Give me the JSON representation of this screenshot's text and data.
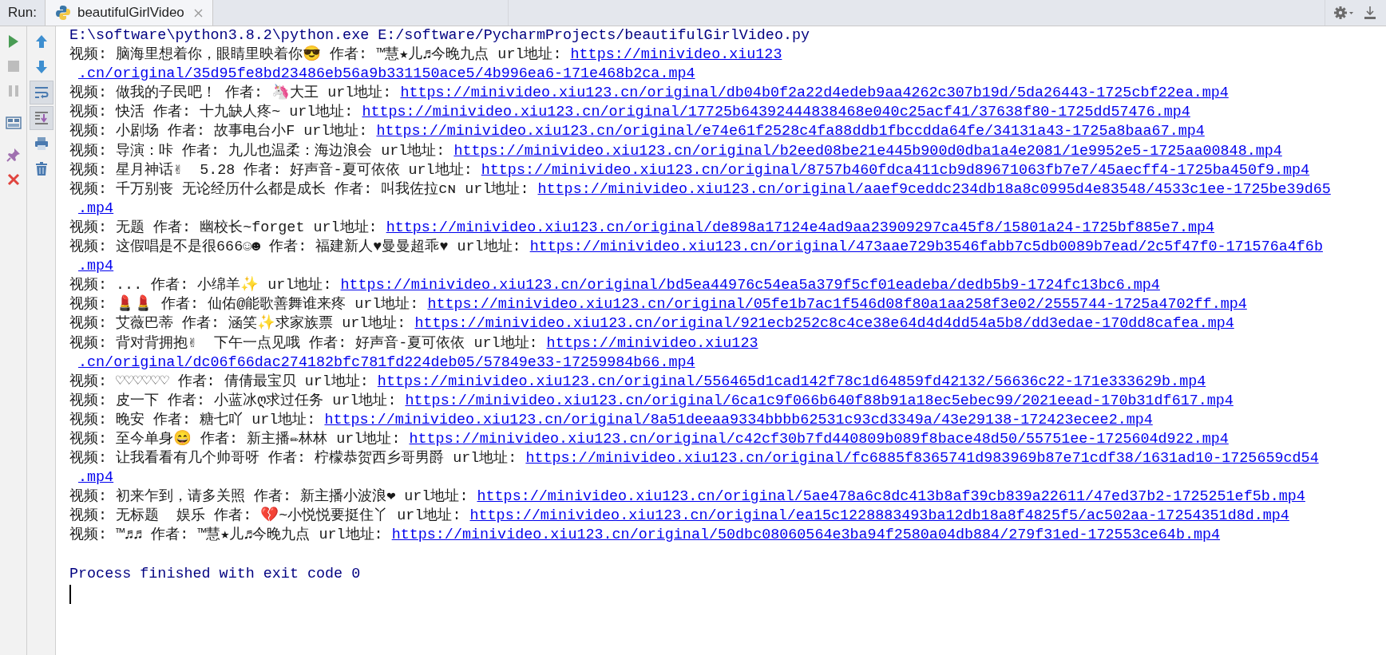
{
  "run_bar": {
    "label": "Run:",
    "tab": {
      "title": "beautifulGirlVideo",
      "selected": true
    }
  },
  "left_toolbar": [
    {
      "kind": "rerun",
      "disabled": false
    },
    {
      "kind": "stop",
      "disabled": true
    },
    {
      "kind": "pause",
      "disabled": true
    },
    {
      "kind": "layout",
      "disabled": false
    },
    {
      "kind": "pin",
      "disabled": false
    },
    {
      "kind": "close",
      "disabled": false
    }
  ],
  "console_toolbar": [
    {
      "kind": "up",
      "selected": false
    },
    {
      "kind": "down",
      "selected": false
    },
    {
      "kind": "wrap",
      "selected": true
    },
    {
      "kind": "scroll-end",
      "selected": true
    },
    {
      "kind": "print",
      "selected": false
    },
    {
      "kind": "trash",
      "selected": false
    }
  ],
  "console": [
    {
      "kind": "command",
      "text": "E:\\software\\python3.8.2\\python.exe E:/software/PycharmProjects/beautifulGirlVideo.py"
    },
    {
      "kind": "entry",
      "text": "视频: 脑海里想着你，眼睛里映着你😎 作者: ™慧★儿♬今晚九点 url地址: ",
      "link": "https://minivideo.xiu123"
    },
    {
      "kind": "continuation",
      "link": ".cn/original/35d95fe8bd23486eb56a9b331150ace5/4b996ea6-171e468b2ca.mp4"
    },
    {
      "kind": "entry",
      "text": "视频: 做我的子民吧！ 作者: 🦄大王 url地址: ",
      "link": "https://minivideo.xiu123.cn/original/db04b0f2a22d4edeb9aa4262c307b19d/5da26443-1725cbf22ea.mp4"
    },
    {
      "kind": "entry",
      "text": "视频: 快活 作者: 十九缺人疼~ url地址: ",
      "link": "https://minivideo.xiu123.cn/original/17725b64392444838468e040c25acf41/37638f80-1725dd57476.mp4"
    },
    {
      "kind": "entry",
      "text": "视频: 小剧场 作者: 故事电台小F url地址: ",
      "link": "https://minivideo.xiu123.cn/original/e74e61f2528c4fa88ddb1fbccdda64fe/34131a43-1725a8baa67.mp4"
    },
    {
      "kind": "entry",
      "text": "视频: 导演：咔 作者: 九儿也温柔：海边浪会 url地址: ",
      "link": "https://minivideo.xiu123.cn/original/b2eed08be21e445b900d0dba1a4e2081/1e9952e5-1725aa00848.mp4"
    },
    {
      "kind": "entry",
      "text": "视频: 星月神话✌  5.28 作者: 好声音-夏可依依 url地址: ",
      "link": "https://minivideo.xiu123.cn/original/8757b460fdca411cb9d89671063fb7e7/45aecff4-1725ba450f9.mp4"
    },
    {
      "kind": "entry",
      "text": "视频: 千万别丧 无论经历什么都是成长 作者: 叫我佐拉ᴄɴ url地址: ",
      "link": "https://minivideo.xiu123.cn/original/aaef9ceddc234db18a8c0995d4e83548/4533c1ee-1725be39d65"
    },
    {
      "kind": "continuation",
      "link": ".mp4"
    },
    {
      "kind": "entry",
      "text": "视频: 无题 作者: 幽校长~forget url地址: ",
      "link": "https://minivideo.xiu123.cn/original/de898a17124e4ad9aa23909297ca45f8/15801a24-1725bf885e7.mp4"
    },
    {
      "kind": "entry",
      "text": "视频: 这假唱是不是很666☺☻ 作者: 福建新人♥曼曼超乖♥ url地址: ",
      "link": "https://minivideo.xiu123.cn/original/473aae729b3546fabb7c5db0089b7ead/2c5f47f0-171576a4f6b"
    },
    {
      "kind": "continuation",
      "link": ".mp4"
    },
    {
      "kind": "entry",
      "text": "视频: ... 作者: 小绵羊✨ url地址: ",
      "link": "https://minivideo.xiu123.cn/original/bd5ea44976c54ea5a379f5cf01eadeba/dedb5b9-1724fc13bc6.mp4"
    },
    {
      "kind": "entry",
      "text": "视频: 💄💄 作者: 仙佑@能歌善舞谁来疼 url地址: ",
      "link": "https://minivideo.xiu123.cn/original/05fe1b7ac1f546d08f80a1aa258f3e02/2555744-1725a4702ff.mp4"
    },
    {
      "kind": "entry",
      "text": "视频: 艾薇巴蒂 作者: 涵笑✨求家族票 url地址: ",
      "link": "https://minivideo.xiu123.cn/original/921ecb252c8c4ce38e64d4d4dd54a5b8/dd3edae-170dd8cafea.mp4"
    },
    {
      "kind": "entry",
      "text": "视频: 背对背拥抱✌  下午一点见哦 作者: 好声音-夏可依依 url地址: ",
      "link": "https://minivideo.xiu123"
    },
    {
      "kind": "continuation",
      "link": ".cn/original/dc06f66dac274182bfc781fd224deb05/57849e33-17259984b66.mp4"
    },
    {
      "kind": "entry",
      "text": "视频: ♡♡♡♡♡♡ 作者: 倩倩最宝贝 url地址: ",
      "link": "https://minivideo.xiu123.cn/original/556465d1cad142f78c1d64859fd42132/56636c22-171e333629b.mp4"
    },
    {
      "kind": "entry",
      "text": "视频: 皮一下 作者: 小蓝冰ღ求过任务 url地址: ",
      "link": "https://minivideo.xiu123.cn/original/6ca1c9f066b640f88b91a18ec5ebec99/2021eead-170b31df617.mp4"
    },
    {
      "kind": "entry",
      "text": "视频: 晚安 作者: 糖七吖 url地址: ",
      "link": "https://minivideo.xiu123.cn/original/8a51deeaa9334bbbb62531c93cd3349a/43e29138-172423ecee2.mp4"
    },
    {
      "kind": "entry",
      "text": "视频: 至今单身😄 作者: 新主播✏林林 url地址: ",
      "link": "https://minivideo.xiu123.cn/original/c42cf30b7fd440809b089f8bace48d50/55751ee-1725604d922.mp4"
    },
    {
      "kind": "entry",
      "text": "视频: 让我看看有几个帅哥呀 作者: 柠檬恭贺西乡哥男爵 url地址: ",
      "link": "https://minivideo.xiu123.cn/original/fc6885f8365741d983969b87e71cdf38/1631ad10-1725659cd54"
    },
    {
      "kind": "continuation",
      "link": ".mp4"
    },
    {
      "kind": "entry",
      "text": "视频: 初来乍到，请多关照 作者: 新主播小波浪❤ url地址: ",
      "link": "https://minivideo.xiu123.cn/original/5ae478a6c8dc413b8af39cb839a22611/47ed37b2-1725251ef5b.mp4"
    },
    {
      "kind": "entry",
      "text": "视频: 无标题  娱乐 作者: 💔~小悦悦要挺住丫 url地址: ",
      "link": "https://minivideo.xiu123.cn/original/ea15c1228883493ba12db18a8f4825f5/ac502aa-17254351d8d.mp4"
    },
    {
      "kind": "entry",
      "text": "视频: ™♬♬ 作者: ™慧★儿♬今晚九点 url地址: ",
      "link": "https://minivideo.xiu123.cn/original/50dbc08060564e3ba94f2580a04db884/279f31ed-172553ce64b.mp4"
    },
    {
      "kind": "status",
      "text": "Process finished with exit code 0"
    }
  ]
}
